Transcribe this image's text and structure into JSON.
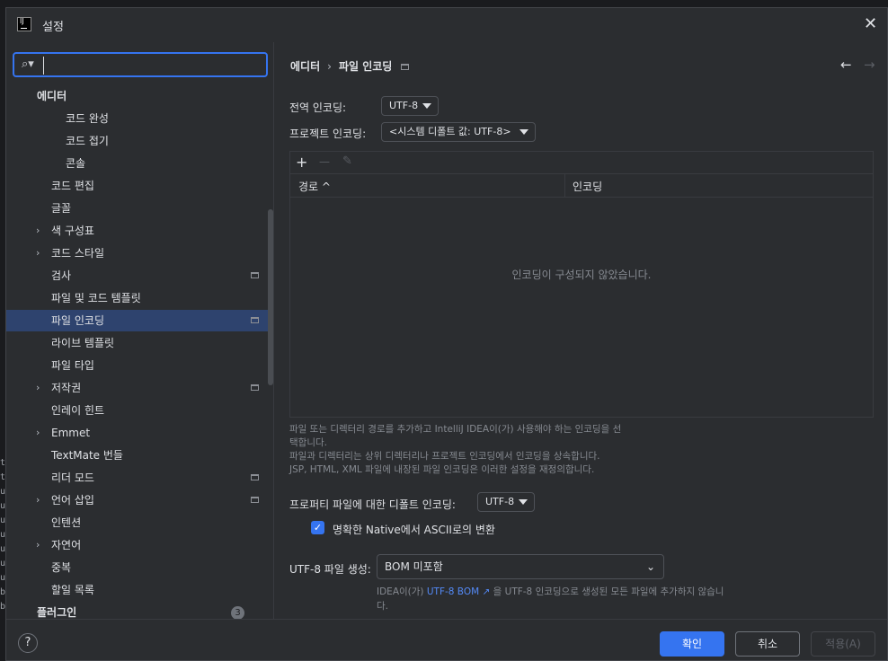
{
  "window": {
    "title": "설정",
    "app_icon": "intellij-icon",
    "close_icon": "close-icon"
  },
  "search": {
    "value": "",
    "placeholder": ""
  },
  "tree": {
    "items": [
      {
        "label": "에디터",
        "bold": true,
        "level": 0
      },
      {
        "label": "코드 완성",
        "level": 2
      },
      {
        "label": "코드 접기",
        "level": 2
      },
      {
        "label": "콘솔",
        "level": 2
      },
      {
        "label": "코드 편집",
        "level": 1
      },
      {
        "label": "글꼴",
        "level": 1
      },
      {
        "label": "색 구성표",
        "level": 1,
        "expandable": true
      },
      {
        "label": "코드 스타일",
        "level": 1,
        "expandable": true
      },
      {
        "label": "검사",
        "level": 1,
        "project": true
      },
      {
        "label": "파일 및 코드 템플릿",
        "level": 1
      },
      {
        "label": "파일 인코딩",
        "level": 1,
        "project": true,
        "selected": true
      },
      {
        "label": "라이브 템플릿",
        "level": 1
      },
      {
        "label": "파일 타입",
        "level": 1
      },
      {
        "label": "저작권",
        "level": 1,
        "expandable": true,
        "project": true
      },
      {
        "label": "인레이 힌트",
        "level": 1
      },
      {
        "label": "Emmet",
        "level": 1,
        "expandable": true
      },
      {
        "label": "TextMate 번들",
        "level": 1
      },
      {
        "label": "리더 모드",
        "level": 1,
        "project": true
      },
      {
        "label": "언어 삽입",
        "level": 1,
        "expandable": true,
        "project": true
      },
      {
        "label": "인텐션",
        "level": 1
      },
      {
        "label": "자연어",
        "level": 1,
        "expandable": true
      },
      {
        "label": "중복",
        "level": 1
      },
      {
        "label": "할일 목록",
        "level": 1
      },
      {
        "label": "플러그인",
        "bold": true,
        "level": 0,
        "badge": "3"
      }
    ]
  },
  "breadcrumb": {
    "parent": "에디터",
    "separator": "›",
    "current": "파일 인코딩"
  },
  "nav": {
    "back": "←",
    "forward": "→"
  },
  "global_encoding": {
    "label": "전역 인코딩:",
    "value": "UTF-8"
  },
  "project_encoding": {
    "label": "프로젝트 인코딩:",
    "value": "<시스템 디폴트 값: UTF-8>"
  },
  "table": {
    "toolbar": {
      "add": "+",
      "remove": "—",
      "edit": "✎"
    },
    "columns": [
      {
        "label": "경로 ^"
      },
      {
        "label": "인코딩"
      }
    ],
    "empty_text": "인코딩이 구성되지 않았습니다."
  },
  "help_lines": [
    "파일 또는 디렉터리 경로를 추가하고 IntelliJ IDEA이(가) 사용해야 하는 인코딩을 선",
    "택합니다.",
    "파일과 디렉터리는 상위 디렉터리나 프로젝트 인코딩에서 인코딩을 상속합니다.",
    "JSP, HTML, XML 파일에 내장된 파일 인코딩은 이러한 설정을 재정의합니다."
  ],
  "properties_encoding": {
    "label": "프로퍼티 파일에 대한 디폴트 인코딩:",
    "value": "UTF-8"
  },
  "native_ascii": {
    "label": "명확한 Native에서 ASCII로의 변환",
    "checked": true
  },
  "bom": {
    "label": "UTF-8 파일 생성:",
    "value": "BOM 미포함"
  },
  "bom_note": {
    "prefix": "IDEA이(가) ",
    "link": "UTF-8 BOM ↗",
    "suffix": " 을 UTF-8 인코딩으로 생성된 모든 파일에 추가하지 않습니",
    "tail": "다."
  },
  "footer": {
    "help": "?",
    "ok": "확인",
    "cancel": "취소",
    "apply": "적용(A)"
  },
  "colors": {
    "accent": "#3574f0",
    "selection": "#2e436e",
    "background": "#2b2d30",
    "link": "#548af7"
  },
  "gutter_chars": [
    "t",
    "t",
    "u",
    "u",
    "u",
    "u",
    "u",
    "u",
    "u",
    "b",
    "b"
  ]
}
